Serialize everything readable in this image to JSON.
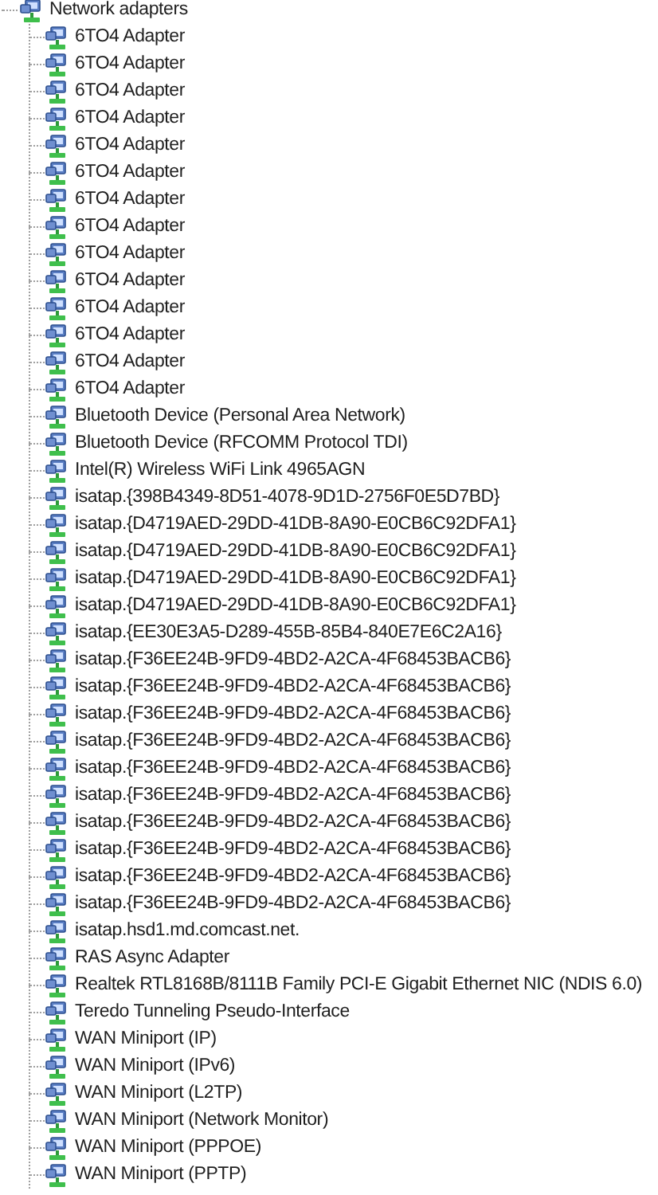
{
  "tree": {
    "label": "Network adapters",
    "children": [
      {
        "label": "6TO4 Adapter"
      },
      {
        "label": "6TO4 Adapter"
      },
      {
        "label": "6TO4 Adapter"
      },
      {
        "label": "6TO4 Adapter"
      },
      {
        "label": "6TO4 Adapter"
      },
      {
        "label": "6TO4 Adapter"
      },
      {
        "label": "6TO4 Adapter"
      },
      {
        "label": "6TO4 Adapter"
      },
      {
        "label": "6TO4 Adapter"
      },
      {
        "label": "6TO4 Adapter"
      },
      {
        "label": "6TO4 Adapter"
      },
      {
        "label": "6TO4 Adapter"
      },
      {
        "label": "6TO4 Adapter"
      },
      {
        "label": "6TO4 Adapter"
      },
      {
        "label": "Bluetooth Device (Personal Area Network)"
      },
      {
        "label": "Bluetooth Device (RFCOMM Protocol TDI)"
      },
      {
        "label": "Intel(R) Wireless WiFi Link 4965AGN"
      },
      {
        "label": "isatap.{398B4349-8D51-4078-9D1D-2756F0E5D7BD}"
      },
      {
        "label": "isatap.{D4719AED-29DD-41DB-8A90-E0CB6C92DFA1}"
      },
      {
        "label": "isatap.{D4719AED-29DD-41DB-8A90-E0CB6C92DFA1}"
      },
      {
        "label": "isatap.{D4719AED-29DD-41DB-8A90-E0CB6C92DFA1}"
      },
      {
        "label": "isatap.{D4719AED-29DD-41DB-8A90-E0CB6C92DFA1}"
      },
      {
        "label": "isatap.{EE30E3A5-D289-455B-85B4-840E7E6C2A16}"
      },
      {
        "label": "isatap.{F36EE24B-9FD9-4BD2-A2CA-4F68453BACB6}"
      },
      {
        "label": "isatap.{F36EE24B-9FD9-4BD2-A2CA-4F68453BACB6}"
      },
      {
        "label": "isatap.{F36EE24B-9FD9-4BD2-A2CA-4F68453BACB6}"
      },
      {
        "label": "isatap.{F36EE24B-9FD9-4BD2-A2CA-4F68453BACB6}"
      },
      {
        "label": "isatap.{F36EE24B-9FD9-4BD2-A2CA-4F68453BACB6}"
      },
      {
        "label": "isatap.{F36EE24B-9FD9-4BD2-A2CA-4F68453BACB6}"
      },
      {
        "label": "isatap.{F36EE24B-9FD9-4BD2-A2CA-4F68453BACB6}"
      },
      {
        "label": "isatap.{F36EE24B-9FD9-4BD2-A2CA-4F68453BACB6}"
      },
      {
        "label": "isatap.{F36EE24B-9FD9-4BD2-A2CA-4F68453BACB6}"
      },
      {
        "label": "isatap.{F36EE24B-9FD9-4BD2-A2CA-4F68453BACB6}"
      },
      {
        "label": "isatap.hsd1.md.comcast.net."
      },
      {
        "label": "RAS Async Adapter"
      },
      {
        "label": "Realtek RTL8168B/8111B Family PCI-E Gigabit Ethernet NIC (NDIS 6.0)"
      },
      {
        "label": "Teredo Tunneling Pseudo-Interface"
      },
      {
        "label": "WAN Miniport (IP)"
      },
      {
        "label": "WAN Miniport (IPv6)"
      },
      {
        "label": "WAN Miniport (L2TP)"
      },
      {
        "label": "WAN Miniport (Network Monitor)"
      },
      {
        "label": "WAN Miniport (PPPOE)"
      },
      {
        "label": "WAN Miniport (PPTP)"
      }
    ]
  }
}
